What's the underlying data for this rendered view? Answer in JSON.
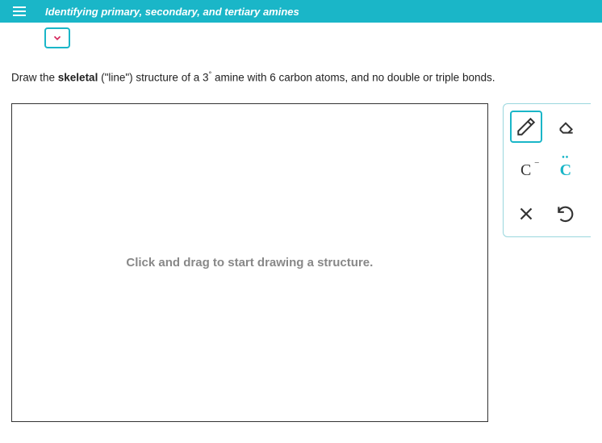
{
  "header": {
    "title": "Identifying primary, secondary, and tertiary amines"
  },
  "question": {
    "prefix": "Draw the ",
    "bold": "skeletal",
    "middle": " (\"line\") structure of a ",
    "degree": "3",
    "suffix": " amine with 6 carbon atoms, and no double or triple bonds."
  },
  "canvas": {
    "placeholder": "Click and drag to start drawing a structure."
  },
  "tools": {
    "pencil": "pencil",
    "eraser": "eraser",
    "c_minus": "C",
    "c_dots": "C",
    "close": "×",
    "undo": "undo"
  }
}
